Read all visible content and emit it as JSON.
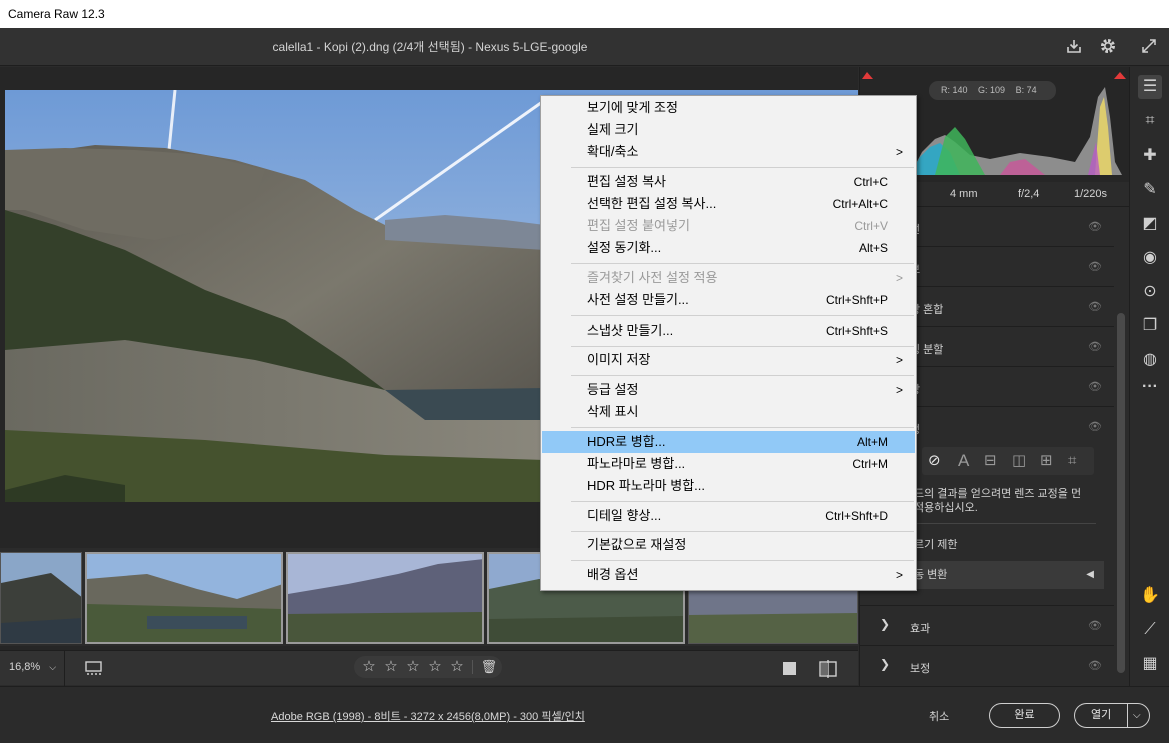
{
  "window": {
    "title": "Camera Raw 12.3"
  },
  "header": {
    "doc_title": "calella1 - Kopi (2).dng (2/4개 선택됨)  -  Nexus 5-LGE-google"
  },
  "histogram": {
    "r": "R: 140",
    "g": "G: 109",
    "b": "B: 74"
  },
  "camera_info": {
    "focal": "4 mm",
    "aperture": "f/2,4",
    "shutter": "1/220s"
  },
  "panel": {
    "sections": [
      {
        "label": "선"
      },
      {
        "label": "브"
      },
      {
        "label": "상 혼합"
      },
      {
        "label": "링 분할"
      },
      {
        "label": "랑"
      },
      {
        "label": "정"
      }
    ],
    "lens_note_line1": "드의 결과를 얻으려면 렌즈 교정을 먼",
    "lens_note_line2": "적용하십시오.",
    "constrain_label": "르기 제한",
    "auto_transform": "동 변환",
    "effects_label": "효과",
    "calibration_label": "보정"
  },
  "context_menu": {
    "items": [
      {
        "label": "보기에 맞게 조정",
        "shortcut": "",
        "arrow": "",
        "disabled": false,
        "highlight": false
      },
      {
        "label": "실제 크기",
        "shortcut": "",
        "arrow": "",
        "disabled": false,
        "highlight": false
      },
      {
        "label": "확대/축소",
        "shortcut": "",
        "arrow": ">",
        "disabled": false,
        "highlight": false
      },
      {
        "label": "편집 설정 복사",
        "shortcut": "Ctrl+C",
        "arrow": "",
        "disabled": false,
        "highlight": false
      },
      {
        "label": "선택한 편집 설정 복사...",
        "shortcut": "Ctrl+Alt+C",
        "arrow": "",
        "disabled": false,
        "highlight": false
      },
      {
        "label": "편집 설정 붙여넣기",
        "shortcut": "Ctrl+V",
        "arrow": "",
        "disabled": true,
        "highlight": false
      },
      {
        "label": "설정 동기화...",
        "shortcut": "Alt+S",
        "arrow": "",
        "disabled": false,
        "highlight": false
      },
      {
        "label": "즐겨찾기 사전 설정 적용",
        "shortcut": "",
        "arrow": ">",
        "disabled": true,
        "highlight": false
      },
      {
        "label": "사전 설정 만들기...",
        "shortcut": "Ctrl+Shft+P",
        "arrow": "",
        "disabled": false,
        "highlight": false
      },
      {
        "label": "스냅샷 만들기...",
        "shortcut": "Ctrl+Shft+S",
        "arrow": "",
        "disabled": false,
        "highlight": false
      },
      {
        "label": "이미지 저장",
        "shortcut": "",
        "arrow": ">",
        "disabled": false,
        "highlight": false
      },
      {
        "label": "등급 설정",
        "shortcut": "",
        "arrow": ">",
        "disabled": false,
        "highlight": false
      },
      {
        "label": "삭제 표시",
        "shortcut": "",
        "arrow": "",
        "disabled": false,
        "highlight": false
      },
      {
        "label": "HDR로 병합...",
        "shortcut": "Alt+M",
        "arrow": "",
        "disabled": false,
        "highlight": true
      },
      {
        "label": "파노라마로 병합...",
        "shortcut": "Ctrl+M",
        "arrow": "",
        "disabled": false,
        "highlight": false
      },
      {
        "label": "HDR 파노라마 병합...",
        "shortcut": "",
        "arrow": "",
        "disabled": false,
        "highlight": false
      },
      {
        "label": "디테일 향상...",
        "shortcut": "Ctrl+Shft+D",
        "arrow": "",
        "disabled": false,
        "highlight": false
      },
      {
        "label": "기본값으로 재설정",
        "shortcut": "",
        "arrow": "",
        "disabled": false,
        "highlight": false
      },
      {
        "label": "배경 옵션",
        "shortcut": "",
        "arrow": ">",
        "disabled": false,
        "highlight": false
      }
    ]
  },
  "bottom_bar": {
    "zoom": "16,8%"
  },
  "footer": {
    "info": "Adobe RGB (1998) - 8비트 - 3272 x 2456(8,0MP) - 300 픽셀/인치",
    "cancel": "취소",
    "ok": "완료",
    "open": "열기"
  }
}
